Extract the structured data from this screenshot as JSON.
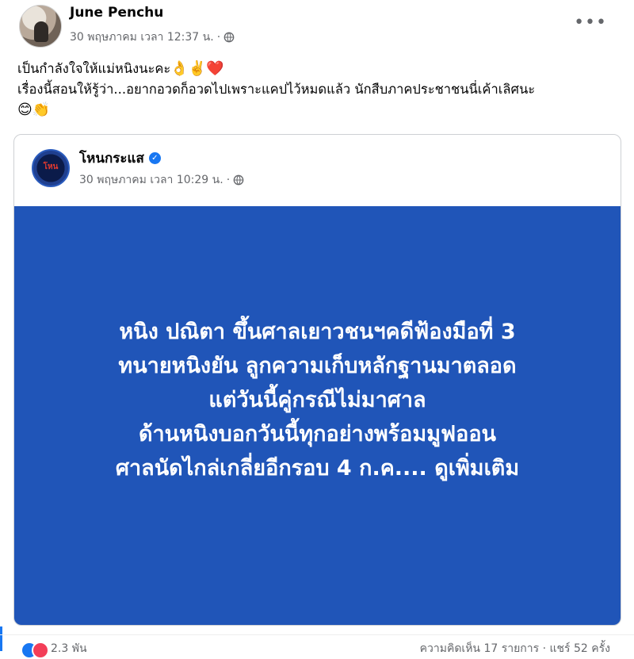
{
  "post": {
    "author": "June Penchu",
    "date": "30 พฤษภาคม เวลา 12:37 น.",
    "separator": "·",
    "more_icon": "•••",
    "lines": [
      "เป็นกำลังใจให้แม่หนิงนะคะ",
      "เรื่องนี้สอนให้รู้ว่า...อยากอวดก็อวดไปเพราะแคปไว้หมดแล้ว นักสืบภาคประชาชนนี่เค้าเลิศนะ"
    ],
    "emojis_line1": "👌✌️❤️",
    "emojis_line3": "😊👏"
  },
  "shared": {
    "page_name": "โหนกระแส",
    "verified_icon": "✓",
    "date": "30 พฤษภาคม เวลา 10:29 น.",
    "separator": "·",
    "avatar_text": "โหน",
    "card_lines": [
      "หนิง ปณิตา ขึ้นศาลเยาวชนฯคดีฟ้องมือที่ 3",
      "ทนายหนิงยัน ลูกความเก็บหลักฐานมาตลอด",
      "แต่วันนี้คู่กรณีไม่มาศาล",
      "ด้านหนิงบอกวันนี้ทุกอย่างพร้อมมูฟออน",
      "ศาลนัดไกล่เกลี่ยอีกรอบ 4 ก.ค.... ดูเพิ่มเติม"
    ],
    "card_color": "#2055b8"
  },
  "footer": {
    "reactions_count": "2.3 พัน",
    "stats": "ความคิดเห็น 17 รายการ · แชร์ 52 ครั้ง"
  }
}
